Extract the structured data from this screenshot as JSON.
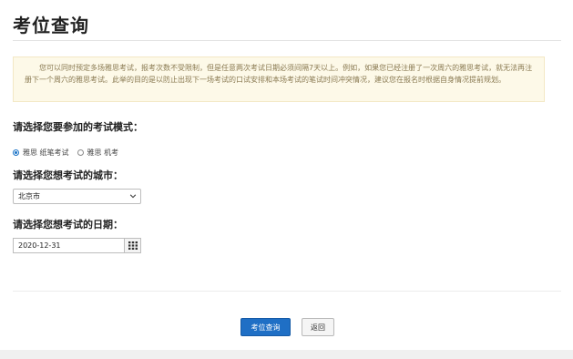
{
  "page": {
    "title": "考位查询"
  },
  "notice": {
    "text": "您可以同时预定多场雅思考试，报考次数不受限制，但是任意两次考试日期必须间隔7天以上。例如，如果您已经注册了一次周六的雅思考试，就无法再注册下一个周六的雅思考试。此举的目的是以防止出现下一场考试的口试安排和本场考试的笔试时间冲突情况，建议您在报名时根据自身情况提前规划。"
  },
  "exam_mode": {
    "label": "请选择您要参加的考试模式：",
    "options": [
      {
        "label": "雅思 纸笔考试",
        "checked": true
      },
      {
        "label": "雅思 机考",
        "checked": false
      }
    ]
  },
  "city": {
    "label": "请选择您想考试的城市：",
    "selected": "北京市"
  },
  "date": {
    "label": "请选择您想考试的日期：",
    "value": "2020-12-31"
  },
  "actions": {
    "search_label": "考位查询",
    "back_label": "返回"
  },
  "colors": {
    "primary": "#1f6fc5",
    "notice_bg": "#fdf9e8",
    "notice_text": "#8a7a52"
  },
  "icons": {
    "select_arrow": "chevron-down-icon",
    "calendar": "calendar-icon"
  }
}
